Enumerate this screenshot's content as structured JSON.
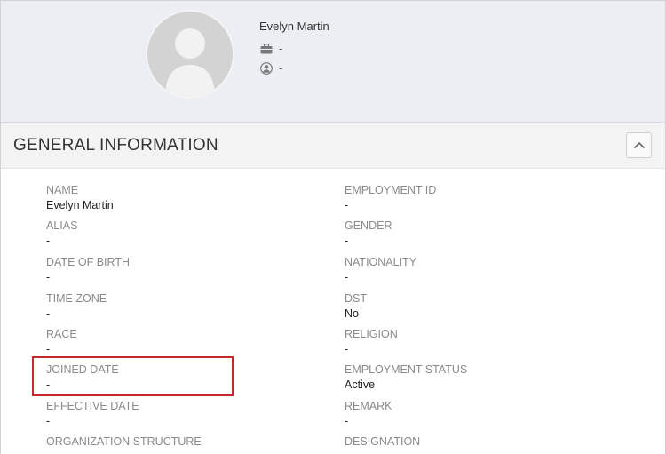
{
  "profile": {
    "name": "Evelyn Martin",
    "job_title": "-",
    "user": "-"
  },
  "section": {
    "title": "GENERAL INFORMATION"
  },
  "fields": {
    "name": {
      "label": "NAME",
      "value": "Evelyn Martin"
    },
    "employment_id": {
      "label": "EMPLOYMENT ID",
      "value": "-"
    },
    "alias": {
      "label": "ALIAS",
      "value": "-"
    },
    "gender": {
      "label": "GENDER",
      "value": "-"
    },
    "date_of_birth": {
      "label": "DATE OF BIRTH",
      "value": "-"
    },
    "nationality": {
      "label": "NATIONALITY",
      "value": "-"
    },
    "time_zone": {
      "label": "TIME ZONE",
      "value": "-"
    },
    "dst": {
      "label": "DST",
      "value": "No"
    },
    "race": {
      "label": "RACE",
      "value": "-"
    },
    "religion": {
      "label": "RELIGION",
      "value": "-"
    },
    "joined_date": {
      "label": "JOINED DATE",
      "value": "-"
    },
    "employment_status": {
      "label": "EMPLOYMENT STATUS",
      "value": "Active"
    },
    "effective_date": {
      "label": "EFFECTIVE DATE",
      "value": "-"
    },
    "remark": {
      "label": "REMARK",
      "value": "-"
    },
    "organization_structure": {
      "label": "ORGANIZATION STRUCTURE"
    },
    "designation": {
      "label": "DESIGNATION"
    }
  },
  "colors": {
    "header_bg": "#eceef3",
    "section_bg": "#f3f3f3",
    "label": "#8a8a8a",
    "highlight": "#c9252c"
  },
  "icons": {
    "avatar": "person-silhouette-icon",
    "job": "briefcase-icon",
    "user": "user-circle-icon",
    "collapse": "chevron-up-icon"
  }
}
